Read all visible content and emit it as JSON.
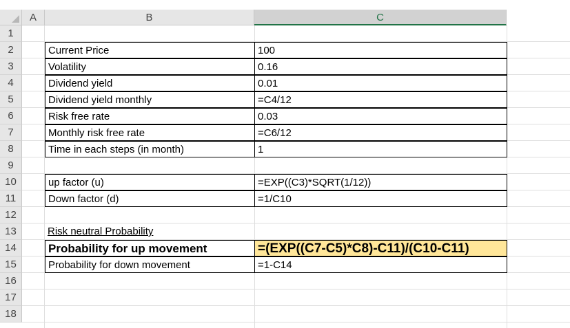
{
  "columns": [
    "A",
    "B",
    "C"
  ],
  "rows": [
    "1",
    "2",
    "3",
    "4",
    "5",
    "6",
    "7",
    "8",
    "9",
    "10",
    "11",
    "12",
    "13",
    "14",
    "15",
    "16",
    "17",
    "18"
  ],
  "table1": [
    {
      "label": "Current Price",
      "value": "100"
    },
    {
      "label": "Volatility",
      "value": "0.16"
    },
    {
      "label": "Dividend yield",
      "value": "0.01"
    },
    {
      "label": "Dividend yield monthly",
      "value": "=C4/12"
    },
    {
      "label": "Risk free rate",
      "value": "0.03"
    },
    {
      "label": "Monthly risk free rate",
      "value": "=C6/12"
    },
    {
      "label": "Time in each steps (in month)",
      "value": "1"
    }
  ],
  "table2": [
    {
      "label": "up factor (u)",
      "value": "=EXP((C3)*SQRT(1/12))"
    },
    {
      "label": "Down factor (d)",
      "value": "=1/C10"
    }
  ],
  "section_title": "Risk neutral Probability",
  "prob_up": {
    "label": "Probability for up movement",
    "value": "=(EXP((C7-C5)*C8)-C11)/(C10-C11)"
  },
  "prob_down": {
    "label": "Probability for down movement",
    "value": "=1-C14"
  },
  "colors": {
    "highlight": "#ffe699",
    "header_bg": "#e6e6e6",
    "selected_header": "#217346"
  }
}
